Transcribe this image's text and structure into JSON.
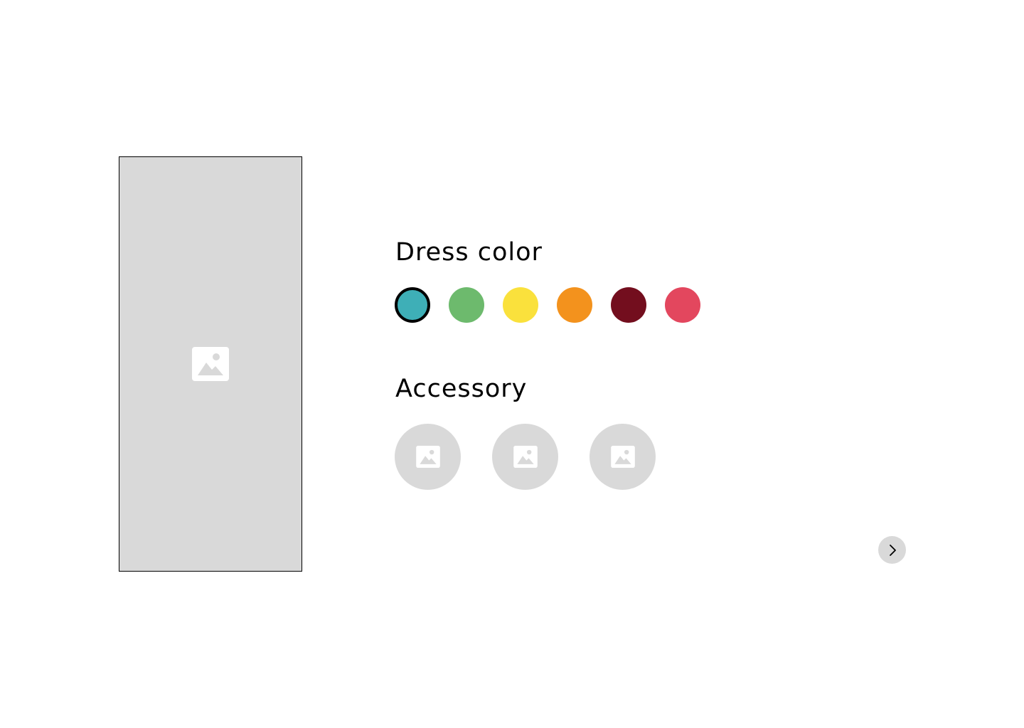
{
  "dress_section": {
    "title": "Dress color",
    "colors": [
      {
        "name": "teal",
        "hex": "#3eafb7",
        "selected": true
      },
      {
        "name": "green",
        "hex": "#6dba6d",
        "selected": false
      },
      {
        "name": "yellow",
        "hex": "#fae13c",
        "selected": false
      },
      {
        "name": "orange",
        "hex": "#f3921d",
        "selected": false
      },
      {
        "name": "maroon",
        "hex": "#730e1e",
        "selected": false
      },
      {
        "name": "pink-red",
        "hex": "#e3475e",
        "selected": false
      }
    ]
  },
  "accessory_section": {
    "title": "Accessory",
    "items": [
      {
        "icon": "image-placeholder-icon"
      },
      {
        "icon": "image-placeholder-icon"
      },
      {
        "icon": "image-placeholder-icon"
      }
    ]
  },
  "preview": {
    "icon": "image-placeholder-icon",
    "background": "#d9d9d9"
  },
  "navigation": {
    "next_icon": "chevron-right-icon"
  }
}
